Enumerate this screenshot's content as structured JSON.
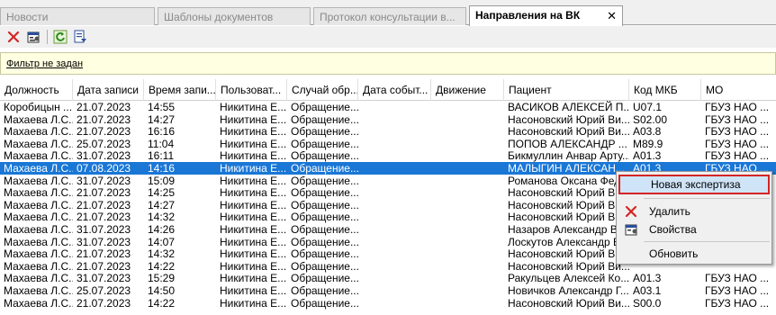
{
  "tabs": [
    {
      "label": "Новости"
    },
    {
      "label": "Шаблоны документов"
    },
    {
      "label": "Протокол консультации в..."
    },
    {
      "label": "Направления на ВК"
    }
  ],
  "tab_close": "✕",
  "filter": {
    "text": "Фильтр не задан"
  },
  "columns": [
    "Должность",
    "Дата записи",
    "Время запи...",
    "Пользоват...",
    "Случай обр...",
    "Дата событ...",
    "Движение",
    "Пациент",
    "Код МКБ",
    "МО"
  ],
  "rows": [
    [
      "Коробицын ...",
      "21.07.2023",
      "14:55",
      "Никитина Е...",
      "Обращение...",
      "",
      "",
      "ВАСИКОВ АЛЕКСЕЙ П...",
      "U07.1",
      "ГБУЗ НАО ..."
    ],
    [
      "Махаева Л.С...",
      "21.07.2023",
      "14:27",
      "Никитина Е...",
      "Обращение...",
      "",
      "",
      "Насоновский Юрий Ви...",
      "S02.00",
      "ГБУЗ НАО ..."
    ],
    [
      "Махаева Л.С...",
      "21.07.2023",
      "16:16",
      "Никитина Е...",
      "Обращение...",
      "",
      "",
      "Насоновский Юрий Ви...",
      "A03.8",
      "ГБУЗ НАО ..."
    ],
    [
      "Махаева Л.С...",
      "25.07.2023",
      "11:04",
      "Никитина Е...",
      "Обращение...",
      "",
      "",
      "ПОПОВ АЛЕКСАНДР ...",
      "M89.9",
      "ГБУЗ НАО ..."
    ],
    [
      "Махаева Л.С...",
      "31.07.2023",
      "16:11",
      "Никитина Е...",
      "Обращение...",
      "",
      "",
      "Бикмуллин Анвар Арту...",
      "A01.3",
      "ГБУЗ НАО ..."
    ],
    [
      "Махаева Л.С...",
      "07.08.2023",
      "14:16",
      "Никитина Е...",
      "Обращение...",
      "",
      "",
      "МАЛЫГИН АЛЕКСАН...",
      "A01.3",
      "ГБУЗ НАО ..."
    ],
    [
      "Махаева Л.С...",
      "31.07.2023",
      "15:09",
      "Никитина Е...",
      "Обращение...",
      "",
      "",
      "Романова Оксана Фед...",
      "",
      ""
    ],
    [
      "Махаева Л.С...",
      "21.07.2023",
      "14:25",
      "Никитина Е...",
      "Обращение...",
      "",
      "",
      "Насоновский Юрий Ви...",
      "",
      ""
    ],
    [
      "Махаева Л.С...",
      "21.07.2023",
      "14:27",
      "Никитина Е...",
      "Обращение...",
      "",
      "",
      "Насоновский Юрий Ви...",
      "",
      ""
    ],
    [
      "Махаева Л.С...",
      "21.07.2023",
      "14:32",
      "Никитина Е...",
      "Обращение...",
      "",
      "",
      "Насоновский Юрий Ви...",
      "",
      ""
    ],
    [
      "Махаева Л.С...",
      "31.07.2023",
      "14:26",
      "Никитина Е...",
      "Обращение...",
      "",
      "",
      "Назаров Александр В...",
      "",
      ""
    ],
    [
      "Махаева Л.С...",
      "31.07.2023",
      "14:07",
      "Никитина Е...",
      "Обращение...",
      "",
      "",
      "Лоскутов Александр В...",
      "",
      ""
    ],
    [
      "Махаева Л.С...",
      "21.07.2023",
      "14:32",
      "Никитина Е...",
      "Обращение...",
      "",
      "",
      "Насоновский Юрий Ви...",
      "",
      ""
    ],
    [
      "Махаева Л.С...",
      "21.07.2023",
      "14:22",
      "Никитина Е...",
      "Обращение...",
      "",
      "",
      "Насоновский Юрий Ви...",
      "",
      ""
    ],
    [
      "Махаева Л.С...",
      "31.07.2023",
      "15:29",
      "Никитина Е...",
      "Обращение...",
      "",
      "",
      "Ракульцев Алексей Ко...",
      "A01.3",
      "ГБУЗ НАО ..."
    ],
    [
      "Махаева Л.С...",
      "25.07.2023",
      "14:50",
      "Никитина Е...",
      "Обращение...",
      "",
      "",
      "Новичков Александр Г...",
      "A03.1",
      "ГБУЗ НАО ..."
    ],
    [
      "Махаева Л.С...",
      "21.07.2023",
      "14:22",
      "Никитина Е...",
      "Обращение...",
      "",
      "",
      "Насоновский Юрий Ви...",
      "S00.0",
      "ГБУЗ НАО ..."
    ]
  ],
  "selected_row": 5,
  "context_menu": {
    "items": [
      "Новая экспертиза",
      "Удалить",
      "Свойства",
      "Обновить"
    ]
  },
  "colors": {
    "selection": "#1a77d6",
    "highlight_border": "#d42424",
    "delete_icon": "#d42424"
  },
  "icons": [
    "delete-icon",
    "properties-icon",
    "refresh-icon",
    "export-icon"
  ]
}
